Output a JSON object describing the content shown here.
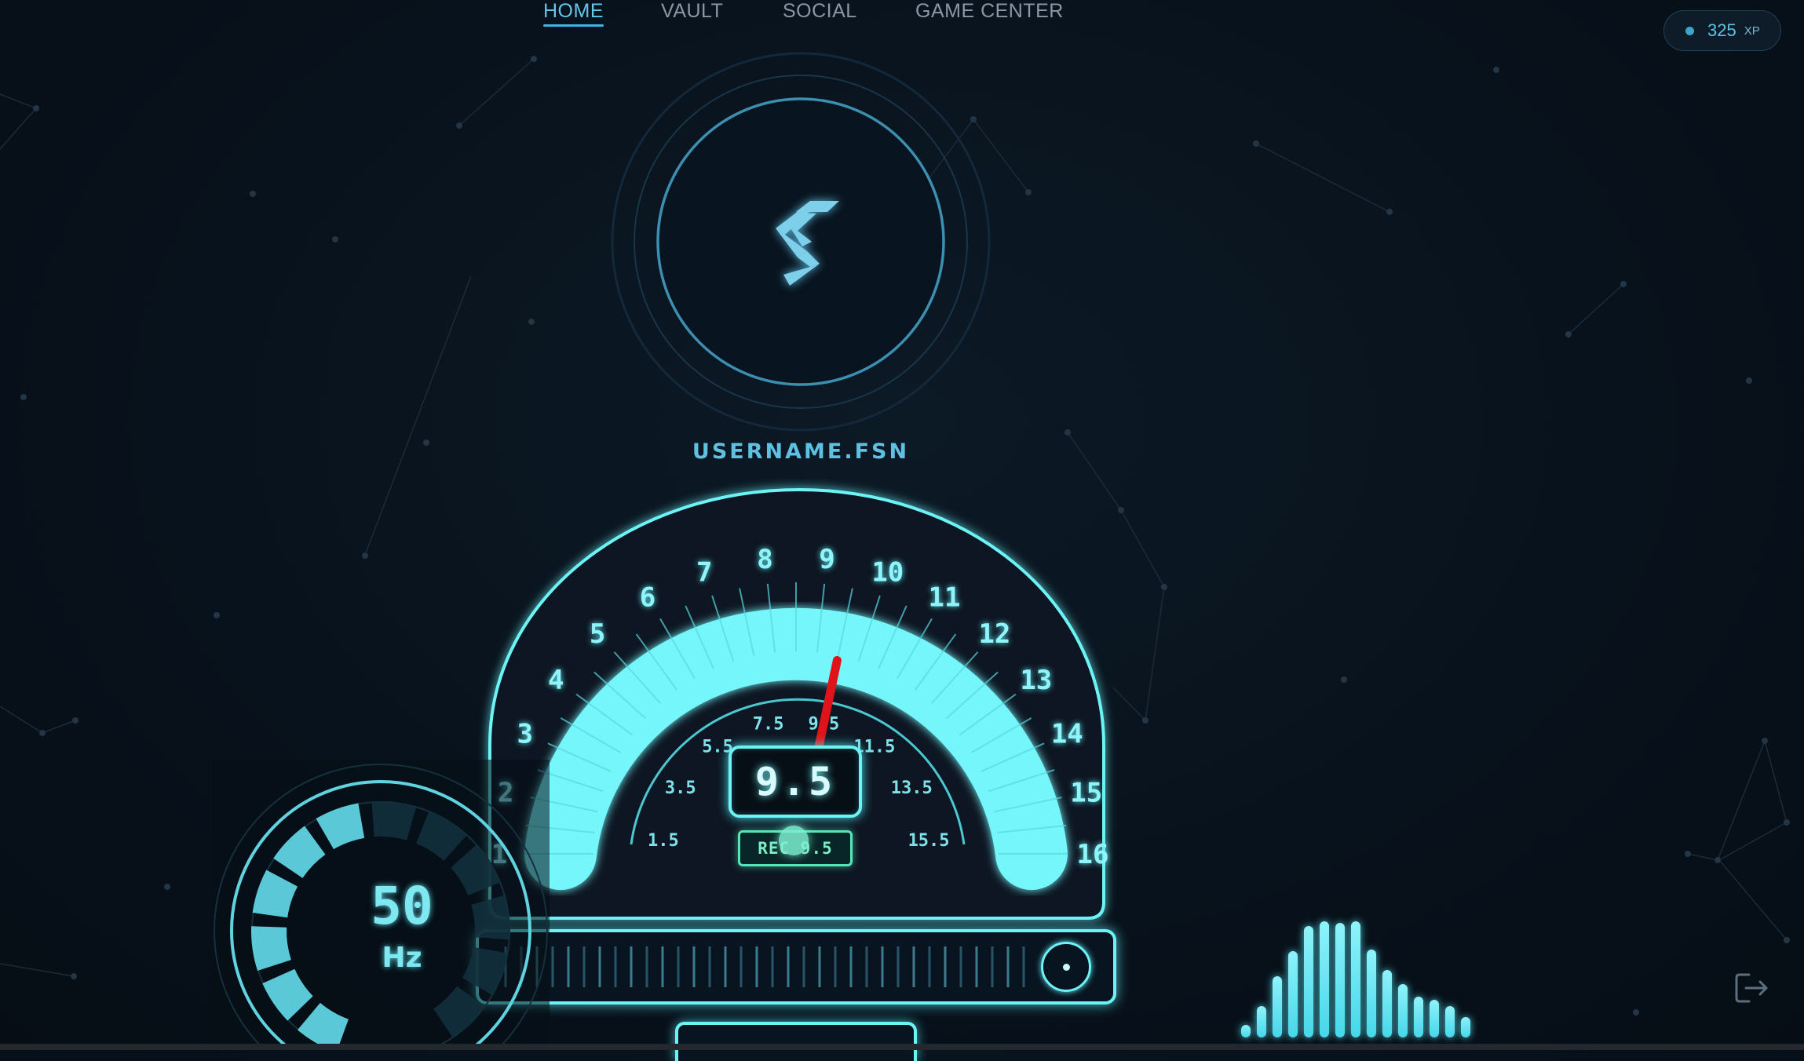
{
  "nav": {
    "items": [
      {
        "label": "HOME",
        "active": true
      },
      {
        "label": "VAULT",
        "active": false
      },
      {
        "label": "SOCIAL",
        "active": false
      },
      {
        "label": "GAME CENTER",
        "active": false
      }
    ]
  },
  "xp": {
    "value": "325",
    "unit": "XP",
    "icon": "status-dot"
  },
  "profile": {
    "logo_icon": "lightning-s-logo-icon",
    "username": "USERNAME.FSN"
  },
  "gauge": {
    "outer_ticks": [
      "1",
      "2",
      "3",
      "4",
      "5",
      "6",
      "7",
      "8",
      "9",
      "10",
      "11",
      "12",
      "13",
      "14",
      "15",
      "16"
    ],
    "inner_ticks": [
      "1.5",
      "3.5",
      "5.5",
      "7.5",
      "9.5",
      "11.5",
      "13.5",
      "15.5"
    ],
    "value": 9.5,
    "readout": "9.5",
    "recommended_label": "REC 9.5",
    "accent": "#6cf3f6",
    "needle_color": "#e0121a"
  },
  "hz": {
    "value": "50",
    "unit": "Hz",
    "level_fraction": 0.5
  },
  "equalizer": {
    "icon": "audio-equalizer-icon"
  },
  "logout": {
    "icon": "logout-icon"
  }
}
